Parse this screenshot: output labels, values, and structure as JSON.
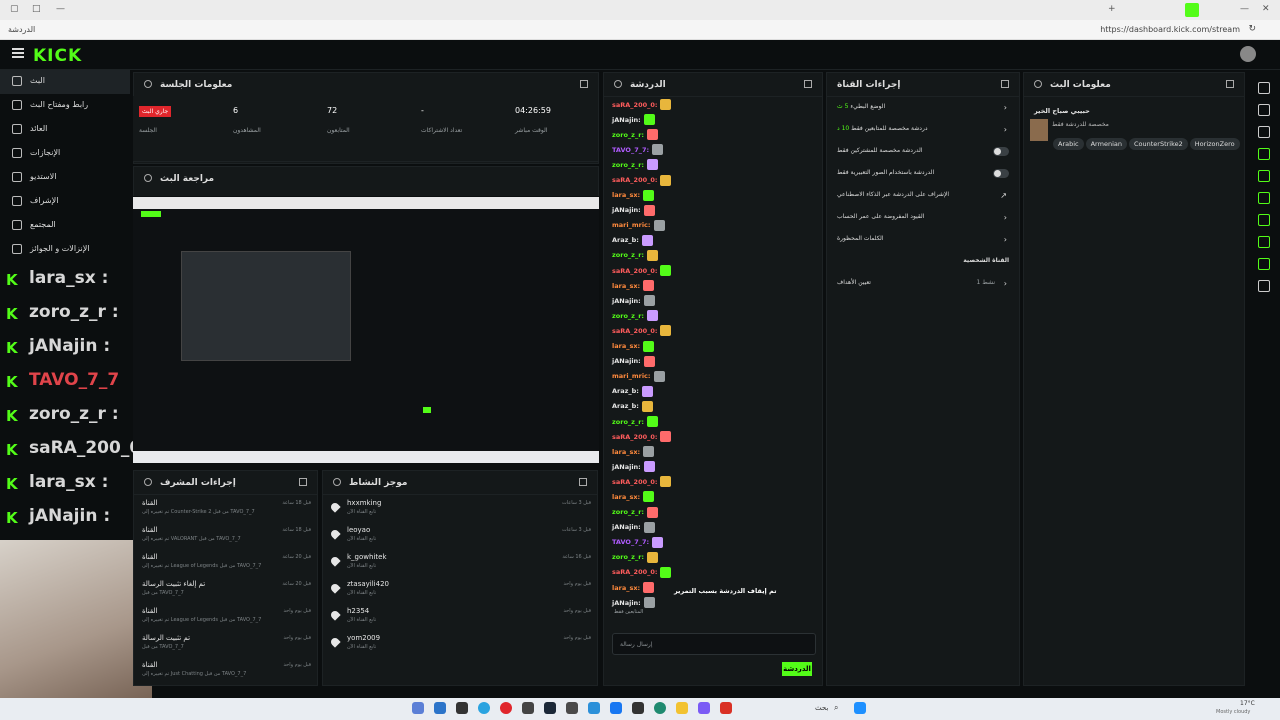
{
  "browser": {
    "url": "https://dashboard.kick.com/stream",
    "tab_label": "الدردشة"
  },
  "brand": {
    "logo": "KICK",
    "accent": "#53fc18"
  },
  "sidebar": {
    "items": [
      {
        "label": "البث"
      },
      {
        "label": "رابط ومفتاح البث"
      },
      {
        "label": "العائد"
      },
      {
        "label": "الإنجازات"
      },
      {
        "label": "الاستديو"
      },
      {
        "label": "الإشراف"
      },
      {
        "label": "المجتمع"
      },
      {
        "label": "الإنزالات و الجوائز"
      }
    ]
  },
  "overlay_chat": [
    {
      "name": "lara_sx :"
    },
    {
      "name": "zoro_z_r :"
    },
    {
      "name": "jANajin :"
    },
    {
      "name": "TAVO_7_7"
    },
    {
      "name": "zoro_z_r :"
    },
    {
      "name": "saRA_200_0 :"
    },
    {
      "name": "lara_sx :"
    },
    {
      "name": "jANajin :"
    }
  ],
  "session": {
    "title": "معلومات الجلسة",
    "live": "جاري البث",
    "session_label": "الجلسة",
    "stats": [
      {
        "value": "6",
        "label": "المشاهدون"
      },
      {
        "value": "72",
        "label": "المتابعون"
      },
      {
        "value": "-",
        "label": "تعداد الاشتراكات"
      },
      {
        "value": "04:26:59",
        "label": "الوقت مباشر"
      }
    ]
  },
  "preview": {
    "title": "مراجعة البث"
  },
  "mod_actions": {
    "title": "إجراءات المشرف",
    "items": [
      {
        "kind": "القناة",
        "text": "تم تغييره إلى Counter-Strike 2 من قبل TAVO_7_7",
        "time": "قبل 18 ساعة"
      },
      {
        "kind": "القناة",
        "text": "تم تغييره إلى VALORANT من قبل TAVO_7_7",
        "time": "قبل 18 ساعة"
      },
      {
        "kind": "القناة",
        "text": "تم تغييره إلى League of Legends من قبل TAVO_7_7",
        "time": "قبل 20 ساعة"
      },
      {
        "kind": "تم إلغاء تثبيت الرسالة",
        "text": "من قبل TAVO_7_7",
        "time": "قبل 20 ساعة"
      },
      {
        "kind": "القناة",
        "text": "تم تغييره إلى League of Legends من قبل TAVO_7_7",
        "time": "قبل يوم واحد"
      },
      {
        "kind": "تم تثبيت الرسالة",
        "text": "من قبل TAVO_7_7",
        "time": "قبل يوم واحد"
      },
      {
        "kind": "القناة",
        "text": "تم تغييره إلى Just Chatting من قبل TAVO_7_7",
        "time": "قبل يوم واحد"
      }
    ]
  },
  "activity": {
    "title": "موجز النشاط",
    "items": [
      {
        "name": "hxxmking",
        "sub": "تابع القناة الآن",
        "time": "قبل 3 ساعات"
      },
      {
        "name": "leoyao",
        "sub": "تابع القناة الآن",
        "time": "قبل 3 ساعات"
      },
      {
        "name": "k_gowhitek",
        "sub": "تابع القناة الآن",
        "time": "قبل 16 ساعة"
      },
      {
        "name": "ztasayili420",
        "sub": "تابع القناة الآن",
        "time": "قبل يوم واحد"
      },
      {
        "name": "h2354",
        "sub": "تابع القناة الآن",
        "time": "قبل يوم واحد"
      },
      {
        "name": "yom2009",
        "sub": "تابع القناة الآن",
        "time": "قبل يوم واحد"
      }
    ]
  },
  "chat": {
    "title": "الدردشة",
    "messages": [
      {
        "user": "saRA_200_0:",
        "color": "#ff5c5c"
      },
      {
        "user": "jANajin:",
        "color": "#e6e6e6"
      },
      {
        "user": "zoro_z_r:",
        "color": "#53fc18"
      },
      {
        "user": "TAVO_7_7:",
        "color": "#b05cff"
      },
      {
        "user": "zoro_z_r:",
        "color": "#53fc18"
      },
      {
        "user": "saRA_200_0:",
        "color": "#ff5c5c"
      },
      {
        "user": "lara_sx:",
        "color": "#ff8a3d"
      },
      {
        "user": "jANajin:",
        "color": "#e6e6e6"
      },
      {
        "user": "mari_mric:",
        "color": "#ff8a3d"
      },
      {
        "user": "Araz_b:",
        "color": "#e6e6e6"
      },
      {
        "user": "zoro_z_r:",
        "color": "#53fc18"
      },
      {
        "user": "saRA_200_0:",
        "color": "#ff5c5c"
      },
      {
        "user": "lara_sx:",
        "color": "#ff8a3d"
      },
      {
        "user": "jANajin:",
        "color": "#e6e6e6"
      },
      {
        "user": "zoro_z_r:",
        "color": "#53fc18"
      },
      {
        "user": "saRA_200_0:",
        "color": "#ff5c5c"
      },
      {
        "user": "lara_sx:",
        "color": "#ff8a3d"
      },
      {
        "user": "jANajin:",
        "color": "#e6e6e6"
      },
      {
        "user": "mari_mric:",
        "color": "#ff8a3d"
      },
      {
        "user": "Araz_b:",
        "color": "#e6e6e6"
      },
      {
        "user": "Araz_b:",
        "color": "#e6e6e6"
      },
      {
        "user": "zoro_z_r:",
        "color": "#53fc18"
      },
      {
        "user": "saRA_200_0:",
        "color": "#ff5c5c"
      },
      {
        "user": "lara_sx:",
        "color": "#ff8a3d"
      },
      {
        "user": "jANajin:",
        "color": "#e6e6e6"
      },
      {
        "user": "saRA_200_0:",
        "color": "#ff5c5c"
      },
      {
        "user": "lara_sx:",
        "color": "#ff8a3d"
      },
      {
        "user": "zoro_z_r:",
        "color": "#53fc18"
      },
      {
        "user": "jANajin:",
        "color": "#e6e6e6"
      },
      {
        "user": "TAVO_7_7:",
        "color": "#b05cff"
      },
      {
        "user": "zoro_z_r:",
        "color": "#53fc18"
      },
      {
        "user": "saRA_200_0:",
        "color": "#ff5c5c"
      },
      {
        "user": "lara_sx:",
        "color": "#ff8a3d"
      },
      {
        "user": "jANajin:",
        "color": "#e6e6e6"
      }
    ],
    "paused": "تم إيقاف الدردشة بسبب التمرير",
    "followers_only": "المتابعين فقط",
    "input_placeholder": "إرسال رسالة",
    "send_label": "الدردشة"
  },
  "quick_actions": {
    "title": "إجراءات القناة",
    "items": [
      {
        "label": "الوضع البطيء",
        "sub": "5 ث",
        "type": "chevron"
      },
      {
        "label": "دردشة مخصصة للمتابعين فقط",
        "sub": "10 د",
        "type": "chevron"
      },
      {
        "label": "الدردشة مخصصة للمشتركين فقط",
        "type": "toggle"
      },
      {
        "label": "الدردشة باستخدام الصور التعبيرية فقط",
        "type": "toggle"
      },
      {
        "label": "الإشراف على الدردشة عبر الذكاء الاصطناعي",
        "type": "external"
      },
      {
        "label": "القيود المفروضة على عمر الحساب",
        "type": "chevron"
      },
      {
        "label": "الكلمات المحظورة",
        "type": "chevron"
      }
    ],
    "personal_header": "القناة الشخصية",
    "goals_label": "تعيين الأهداف",
    "goals_sub": "نشط 1"
  },
  "stream_info": {
    "title": "معلومات البث",
    "stream_title": "حبيبي صباح الخير",
    "subtitle": "مخصصة للدردشة فقط",
    "tags": [
      "Arabic",
      "Armenian",
      "CounterStrike2",
      "HorizonZero"
    ]
  },
  "taskbar": {
    "search": "بحث",
    "weather": "17°C",
    "weather_sub": "Mostly cloudy"
  }
}
